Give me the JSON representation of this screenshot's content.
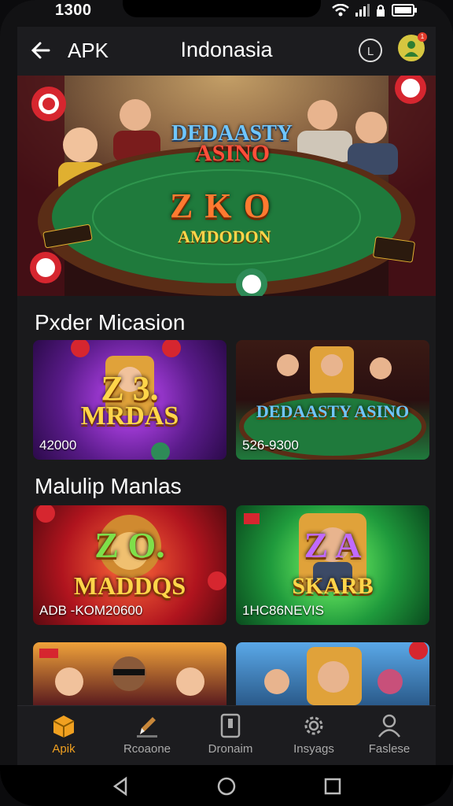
{
  "status": {
    "time": "1300"
  },
  "appbar": {
    "back_label": "APK",
    "title": "Indonasia",
    "lang_label": "L",
    "badge": "1"
  },
  "banner": {
    "logo_top": "DEDAASTY",
    "logo_bottom": "ASINO",
    "center_text": "Z K O",
    "subtitle": "AMDODON"
  },
  "sections": [
    {
      "title": "Pxder Micasion",
      "cards": [
        {
          "title": "MRDAS",
          "letters": "Z 3.",
          "code": "42000"
        },
        {
          "title": "DEDAASTY ASINO",
          "letters": "",
          "code": "526-9300"
        }
      ]
    },
    {
      "title": "Malulip Manlas",
      "cards": [
        {
          "title": "MADDQS",
          "letters": "Z O.",
          "code": "ADB -KOM20600"
        },
        {
          "title": "SKARB",
          "letters": "Z A",
          "code": "1HC86NEVIS"
        }
      ]
    }
  ],
  "nav": [
    {
      "label": "Apik",
      "icon": "box-icon",
      "active": true
    },
    {
      "label": "Rcoaone",
      "icon": "pencil-icon",
      "active": false
    },
    {
      "label": "Dronaim",
      "icon": "device-icon",
      "active": false
    },
    {
      "label": "Insyags",
      "icon": "gear-icon",
      "active": false
    },
    {
      "label": "Faslese",
      "icon": "person-icon",
      "active": false
    }
  ],
  "colors": {
    "accent": "#f0a020",
    "felt": "#1f7a3c",
    "nav_bg": "#1c1c1f"
  }
}
